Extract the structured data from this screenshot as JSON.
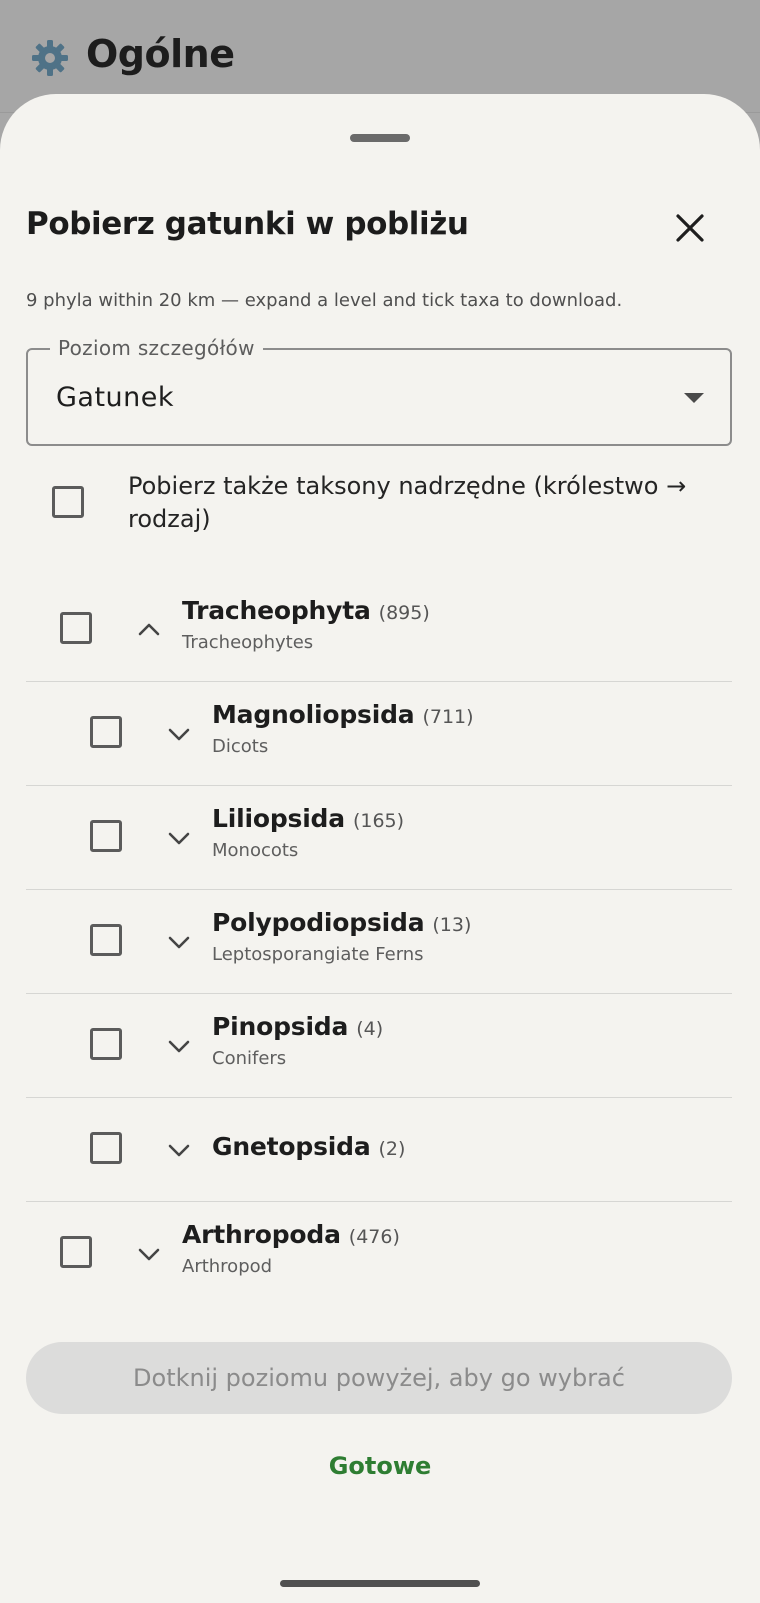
{
  "header": {
    "title": "Ogólne",
    "icon": "gear-icon"
  },
  "sheet": {
    "title": "Pobierz gatunki w pobliżu",
    "subtitle": "9 phyla within 20 km — expand a level and tick taxa to download.",
    "detail_level": {
      "label": "Poziom szczegółów",
      "value": "Gatunek"
    },
    "include_parents": {
      "label": "Pobierz także taksony nadrzędne (królestwo → rodzaj)",
      "checked": false
    },
    "taxa": [
      {
        "name": "Tracheophyta",
        "count": "(895)",
        "common": "Tracheophytes",
        "expanded": true
      },
      {
        "name": "Magnoliopsida",
        "count": "(711)",
        "common": "Dicots",
        "expanded": false
      },
      {
        "name": "Liliopsida",
        "count": "(165)",
        "common": "Monocots",
        "expanded": false
      },
      {
        "name": "Polypodiopsida",
        "count": "(13)",
        "common": "Leptosporangiate Ferns",
        "expanded": false
      },
      {
        "name": "Pinopsida",
        "count": "(4)",
        "common": "Conifers",
        "expanded": false
      },
      {
        "name": "Gnetopsida",
        "count": "(2)",
        "common": "",
        "expanded": false
      },
      {
        "name": "Arthropoda",
        "count": "(476)",
        "common": "Arthropod",
        "expanded": false
      }
    ],
    "hint_button": "Dotknij poziomu powyżej, aby go wybrać",
    "done_button": "Gotowe"
  },
  "colors": {
    "accent": "#2e7d32",
    "sheet_background": "#f4f3ef",
    "scrim": "#a7a7a7"
  }
}
